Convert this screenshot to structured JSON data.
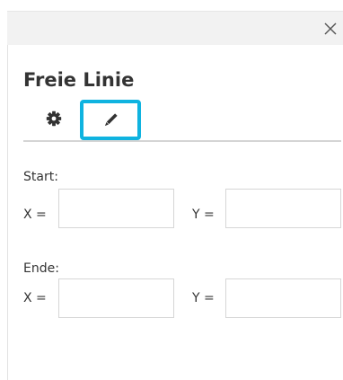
{
  "panel": {
    "title": "Freie Linie",
    "close_symbol": "×"
  },
  "tabs": [
    {
      "icon": "gear-icon"
    },
    {
      "icon": "pencil-icon",
      "selected": true
    }
  ],
  "start": {
    "label": "Start:",
    "x_label": "X =",
    "y_label": "Y =",
    "x_value": "",
    "y_value": ""
  },
  "end": {
    "label": "Ende:",
    "x_label": "X =",
    "y_label": "Y =",
    "x_value": "",
    "y_value": ""
  },
  "colors": {
    "accent": "#0fb3e0",
    "header_bg": "#f2f2f2",
    "text": "#333333",
    "border": "#d6d6d6"
  }
}
